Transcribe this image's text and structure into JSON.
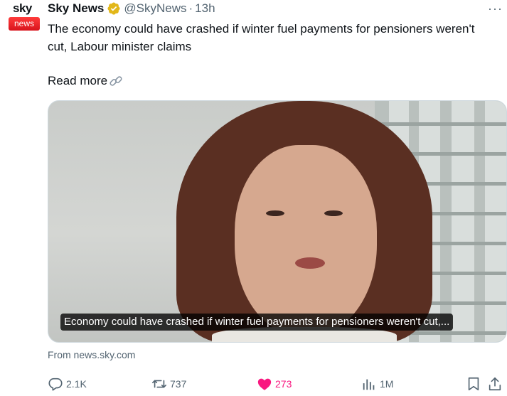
{
  "account": {
    "avatar_line1": "sky",
    "avatar_line2": "news",
    "name": "Sky News",
    "handle": "@SkyNews",
    "separator": "·",
    "time": "13h",
    "verified_icon": "gold-verified-badge"
  },
  "menu": {
    "label": "···"
  },
  "tweet": {
    "text": "The economy could have crashed if winter fuel payments for pensioners weren't cut, Labour minister claims",
    "read_more": "Read more"
  },
  "media": {
    "caption": "Economy could have crashed if winter fuel payments for pensioners weren't cut,..."
  },
  "link_source": "From news.sky.com",
  "actions": {
    "replies": "2.1K",
    "reposts": "737",
    "likes": "273",
    "views": "1M"
  },
  "colors": {
    "text": "#0f1419",
    "secondary": "#536471",
    "like": "#f91880",
    "verified": "#e2b719",
    "brand_red": "#d8141d"
  }
}
